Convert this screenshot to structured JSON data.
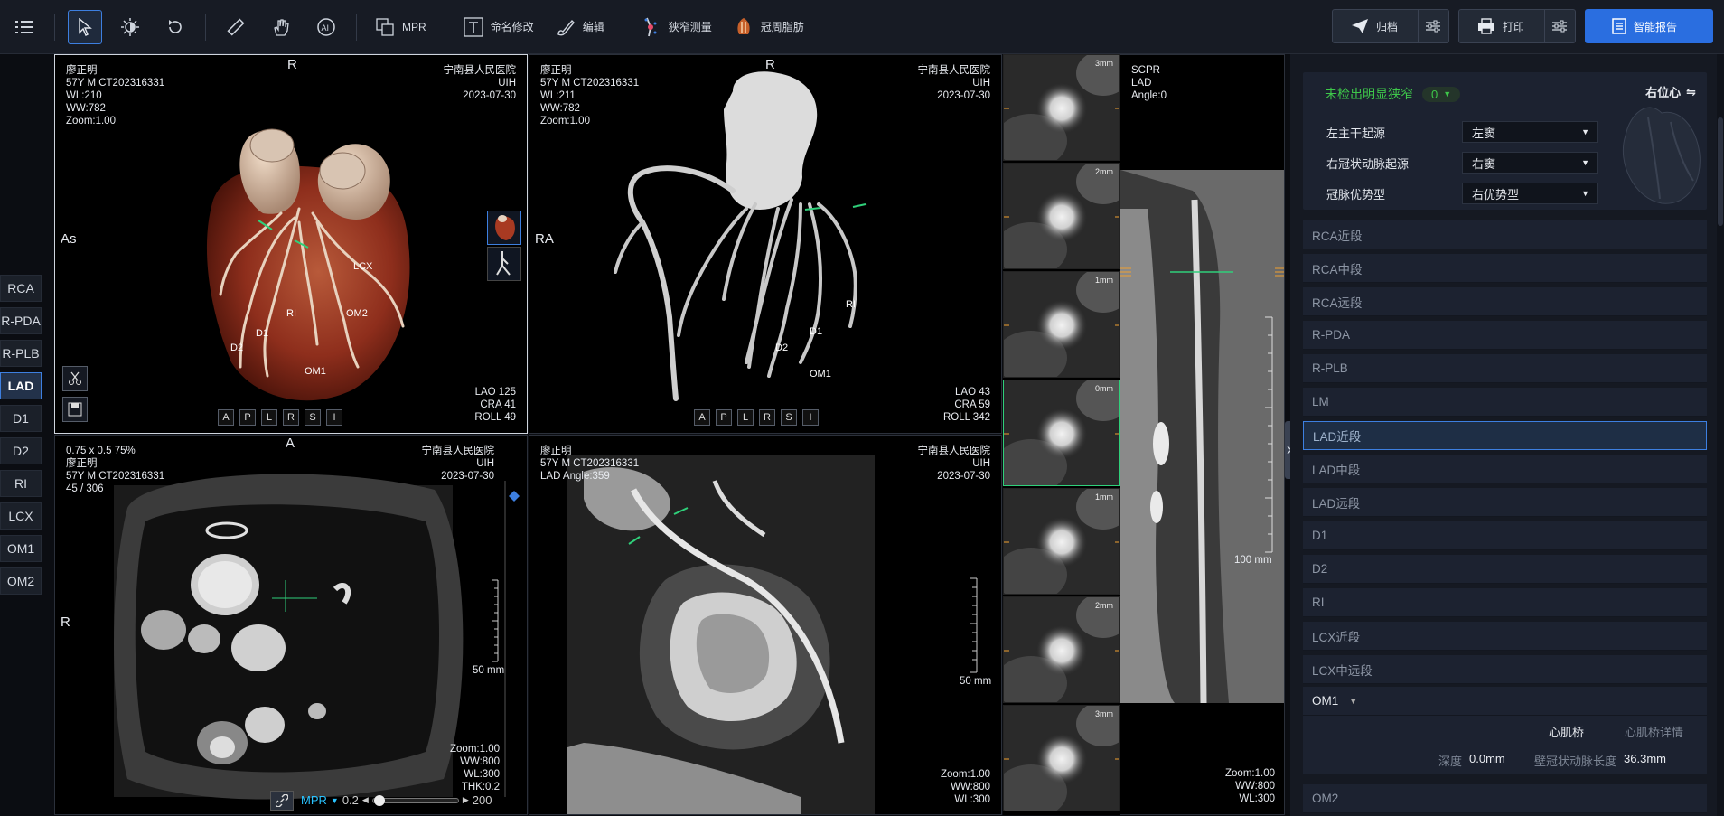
{
  "toolbar": {
    "mpr_label": "MPR",
    "rename_label": "命名修改",
    "edit_label": "编辑",
    "stenosis_label": "狭窄测量",
    "fat_label": "冠周脂肪",
    "archive_label": "归档",
    "print_label": "打印",
    "report_label": "智能报告"
  },
  "segments": [
    "RCA",
    "R-PDA",
    "R-PLB",
    "LAD",
    "D1",
    "D2",
    "RI",
    "LCX",
    "OM1",
    "OM2"
  ],
  "active_segment": "LAD",
  "vr": {
    "name": "廖正明",
    "id": "57Y M CT202316331",
    "wl": "WL:210",
    "ww": "WW:782",
    "zoom": "Zoom:1.00",
    "hospital": "宁南县人民医院",
    "vendor": "UIH",
    "date": "2023-07-30",
    "top_orient": "R",
    "left_orient": "As",
    "angle1": "LAO 125",
    "angle2": "CRA 41",
    "angle3": "ROLL 49",
    "labels": {
      "lcx": "LCX",
      "ri": "RI",
      "om2": "OM2",
      "d1": "D1",
      "d2": "D2",
      "om1": "OM1"
    }
  },
  "mip": {
    "name": "廖正明",
    "id": "57Y M CT202316331",
    "wl": "WL:211",
    "ww": "WW:782",
    "zoom": "Zoom:1.00",
    "hospital": "宁南县人民医院",
    "vendor": "UIH",
    "date": "2023-07-30",
    "top_orient": "R",
    "left_orient": "RA",
    "angle1": "LAO 43",
    "angle2": "CRA 59",
    "angle3": "ROLL 342",
    "labels": {
      "ri": "RI",
      "d1": "D1",
      "d2": "D2",
      "om1": "OM1"
    }
  },
  "view_buttons": [
    "A",
    "P",
    "L",
    "R",
    "S",
    "I"
  ],
  "axial": {
    "thickness": "0.75 x 0.5 75%",
    "name": "廖正明",
    "id": "57Y M CT202316331",
    "slice": "45 / 306",
    "hospital": "宁南县人民医院",
    "vendor": "UIH",
    "date": "2023-07-30",
    "top_orient": "A",
    "left_orient": "R",
    "scale": "50 mm",
    "zoom": "Zoom:1.00",
    "ww": "WW:800",
    "wl": "WL:300",
    "thk": "THK:0.2",
    "mpr": "MPR",
    "slider_min": "0.2",
    "slider_max": "200",
    "slider_value": 0.02
  },
  "curved": {
    "name": "廖正明",
    "id": "57Y M CT202316331",
    "angle": "LAD Angle:359",
    "hospital": "宁南县人民医院",
    "vendor": "UIH",
    "date": "2023-07-30",
    "scale": "50 mm",
    "zoom": "Zoom:1.00",
    "ww": "WW:800",
    "wl": "WL:300"
  },
  "cross_sections": [
    "3mm",
    "2mm",
    "1mm",
    "0mm",
    "1mm",
    "2mm",
    "3mm"
  ],
  "scpr": {
    "title": "SCPR",
    "vessel": "LAD",
    "angle": "Angle:0",
    "scale": "100 mm",
    "zoom": "Zoom:1.00",
    "ww": "WW:800",
    "wl": "WL:300"
  },
  "panel": {
    "status": "未检出明显狭窄",
    "count": "0",
    "heart_pos": "右位心",
    "rows": [
      {
        "label": "左主干起源",
        "value": "左窦"
      },
      {
        "label": "右冠状动脉起源",
        "value": "右窦"
      },
      {
        "label": "冠脉优势型",
        "value": "右优势型"
      }
    ],
    "segments": [
      "RCA近段",
      "RCA中段",
      "RCA远段",
      "R-PDA",
      "R-PLB",
      "LM",
      "LAD近段",
      "LAD中段",
      "LAD远段",
      "D1",
      "D2",
      "RI",
      "LCX近段",
      "LCX中远段"
    ],
    "active_segment": "LAD近段",
    "om1": "OM1",
    "tab_bridge": "心肌桥",
    "tab_detail": "心肌桥详情",
    "depth_label": "深度",
    "depth_value": "0.0mm",
    "length_label": "壁冠状动脉长度",
    "length_value": "36.3mm",
    "om2": "OM2"
  },
  "colors": {
    "accent": "#3d7fe0",
    "primary": "#2a6ee0",
    "success": "#3ec74a",
    "marker": "#2fd07a"
  }
}
